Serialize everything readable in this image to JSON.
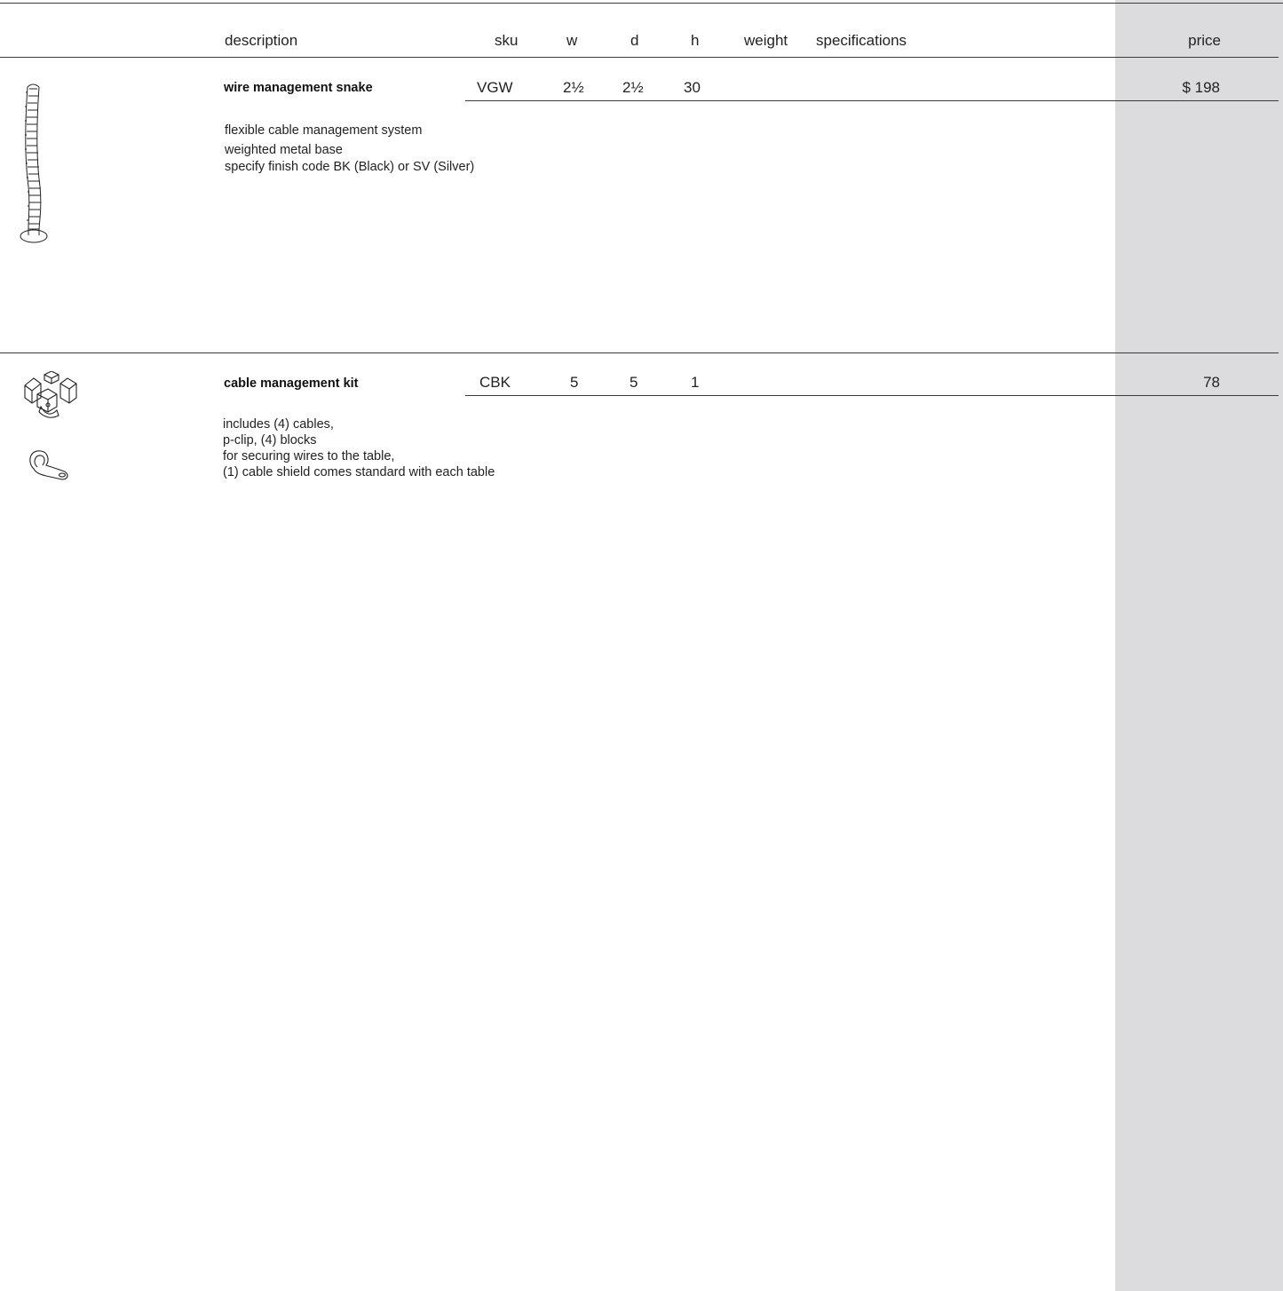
{
  "header": {
    "description": "description",
    "sku": "sku",
    "w": "w",
    "d": "d",
    "h": "h",
    "weight": "weight",
    "specifications": "specifications",
    "price": "price"
  },
  "products": [
    {
      "name": "wire management snake",
      "sku": "VGW",
      "w": "2½",
      "d": "2½",
      "h": "30",
      "weight": "",
      "price": "$ 198",
      "details": [
        "flexible cable management system",
        "weighted metal base",
        "specify finish code BK (Black) or SV (Silver)"
      ],
      "icons": [
        "cable-snake-icon"
      ]
    },
    {
      "name": "cable management kit",
      "sku": "CBK",
      "w": "5",
      "d": "5",
      "h": "1",
      "weight": "",
      "price": "78",
      "details": [
        "includes (4) cables,",
        "p-clip, (4) blocks",
        "for securing wires to the table,",
        "(1) cable shield comes standard with each table"
      ],
      "icons": [
        "cable-blocks-icon",
        "p-clip-icon"
      ]
    }
  ],
  "colors": {
    "price_band": "#dcdcde",
    "rule": "#3a3a3a",
    "text": "#222222"
  }
}
